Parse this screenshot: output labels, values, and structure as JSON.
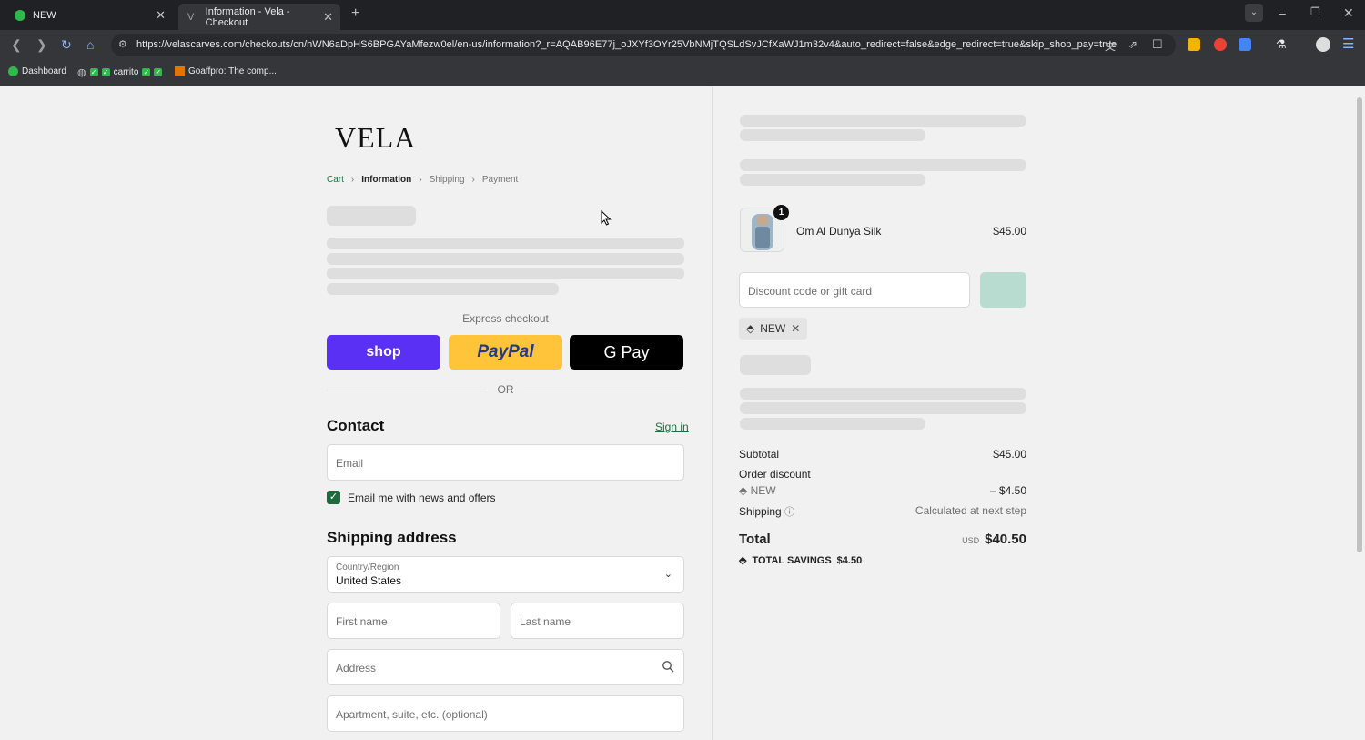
{
  "browser": {
    "tabs": [
      {
        "title": "NEW",
        "favicon_color": "#2fb84b"
      },
      {
        "title": "Information - Vela - Checkout",
        "favicon_color": "#9aa0a6"
      }
    ],
    "url": "https://velascarves.com/checkouts/cn/hWN6aDpHS6BPGAYaMfezw0el/en-us/information?_r=AQAB96E77j_oJXYf3OYr25VbNMjTQSLdSvJCfXaWJ1m32v4&auto_redirect=false&edge_redirect=true&skip_shop_pay=true",
    "bookmarks": [
      {
        "label": "Dashboard"
      },
      {
        "label": "carrito"
      },
      {
        "label": "Goaffpro: The comp..."
      }
    ]
  },
  "checkout": {
    "logo": "VELA",
    "breadcrumb": {
      "cart": "Cart",
      "information": "Information",
      "shipping": "Shipping",
      "payment": "Payment"
    },
    "express_checkout": "Express checkout",
    "pay_buttons": {
      "shop": "shop",
      "paypal": "PayPal",
      "gpay": "G Pay"
    },
    "or_label": "OR",
    "contact": {
      "heading": "Contact",
      "sign_in": "Sign in",
      "email_placeholder": "Email",
      "newsletter_label": "Email me with news and offers",
      "newsletter_checked": true
    },
    "shipping": {
      "heading": "Shipping address",
      "country_label": "Country/Region",
      "country_value": "United States",
      "first_name_placeholder": "First name",
      "last_name_placeholder": "Last name",
      "address_placeholder": "Address",
      "apartment_placeholder": "Apartment, suite, etc. (optional)"
    }
  },
  "summary": {
    "product": {
      "name": "Om Al Dunya Silk",
      "price": "$45.00",
      "quantity": "1"
    },
    "discount_placeholder": "Discount code or gift card",
    "applied_code": "NEW",
    "subtotal_label": "Subtotal",
    "subtotal_value": "$45.00",
    "order_discount_label": "Order discount",
    "discount_code": "NEW",
    "discount_value": "– $4.50",
    "shipping_label": "Shipping",
    "shipping_value": "Calculated at next step",
    "total_label": "Total",
    "currency": "USD",
    "total_value": "$40.50",
    "savings_label": "TOTAL SAVINGS",
    "savings_value": "$4.50"
  }
}
